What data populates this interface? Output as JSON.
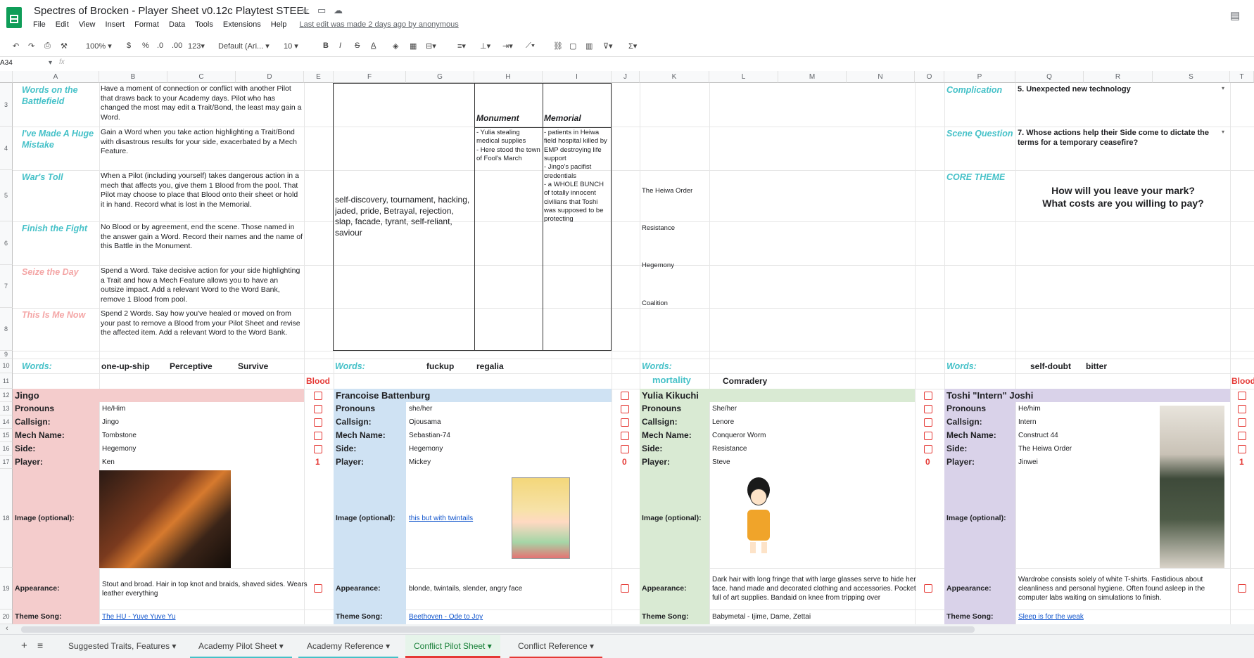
{
  "header": {
    "title": "Spectres of Brocken - Player Sheet v0.12c Playtest STEEL",
    "menus": [
      "File",
      "Edit",
      "View",
      "Insert",
      "Format",
      "Data",
      "Tools",
      "Extensions",
      "Help"
    ],
    "last_edit": "Last edit was made 2 days ago by anonymous"
  },
  "toolbar": {
    "zoom": "100%",
    "currency": "$",
    "percent": "%",
    "dec_minus": ".0",
    "dec_plus": ".00",
    "format_123": "123",
    "font": "Default (Ari...",
    "font_size": "10"
  },
  "formula_bar": {
    "name_box": "A34",
    "fx": "fx"
  },
  "columns": [
    "A",
    "B",
    "C",
    "D",
    "E",
    "F",
    "G",
    "H",
    "I",
    "J",
    "K",
    "L",
    "M",
    "N",
    "O",
    "P",
    "Q",
    "R",
    "S",
    "T"
  ],
  "rows": [
    "3",
    "4",
    "5",
    "6",
    "7",
    "8",
    "9",
    "10",
    "11",
    "12",
    "13",
    "14",
    "15",
    "16",
    "17",
    "18",
    "19",
    "20"
  ],
  "moves": [
    {
      "name": "Words on the Battlefield",
      "text": "Have a moment of connection or conflict  with another Pilot that draws back to your Academy days. Pilot who has changed the most may edit a Trait/Bond, the least may gain a Word."
    },
    {
      "name": "I've Made A Huge Mistake",
      "text": "Gain a Word when you take action highlighting a Trait/Bond with disastrous results for your side, exacerbated by a Mech Feature."
    },
    {
      "name": "War's Toll",
      "text": "When a Pilot (including yourself) takes dangerous action in a mech that affects you, give them 1 Blood from the pool. That Pilot may choose to place that Blood onto their sheet or hold it in hand. Record what is lost in the Memorial."
    },
    {
      "name": "Finish the Fight",
      "text": "No Blood or by agreement, end the scene. Those named in the answer gain a Word. Record their names and the name of this Battle in the Monument."
    },
    {
      "name": "Seize the Day",
      "text": "Spend a Word. Take decisive action for your side highlighting a Trait and how a Mech Feature allows you to have an outsize impact. Add a relevant Word to the Word Bank, remove 1 Blood from pool."
    },
    {
      "name": "This Is Me Now",
      "text": "Spend 2 Words. Say how you've healed or moved on from your past to remove a Blood from your Pilot Sheet and revise the affected item. Add a relevant Word to the Word Bank."
    }
  ],
  "word_bank": "self-discovery, tournament, hacking, jaded, pride, Betrayal, rejection, slap, facade, tyrant, self-reliant, saviour",
  "monument": {
    "title": "Monument",
    "text": "- Yulia stealing medical supplies\n- Here stood the town of Fool's March"
  },
  "memorial": {
    "title": "Memorial",
    "text": "- patients in Heiwa field hospital killed by EMP destroying life support\n- Jingo's pacifist credentials\n- a WHOLE BUNCH of totally innocent civilians that Toshi was supposed to be protecting"
  },
  "sides": [
    "The Heiwa Order",
    "Resistance",
    "Hegemony",
    "Coalition"
  ],
  "complication": {
    "label": "Complication",
    "value": "5. Unexpected new technology"
  },
  "scene_question": {
    "label": "Scene Question",
    "value": "7. Whose actions help their Side come to dictate the terms for a temporary ceasefire?"
  },
  "core_theme": {
    "label": "CORE THEME",
    "value": "How will you leave your mark?\nWhat costs are you willing to pay?"
  },
  "words_row": {
    "label": "Words:",
    "a": [
      "one-up-ship",
      "Perceptive",
      "Survive"
    ],
    "b": [
      "fuckup",
      "regalia"
    ],
    "d": [
      "self-doubt",
      "bitter"
    ]
  },
  "row11": {
    "blood": "Blood",
    "mortality": "mortality",
    "comradery": "Comradery"
  },
  "field_labels": {
    "pronouns": "Pronouns",
    "callsign": "Callsign:",
    "mech": "Mech Name:",
    "side": "Side:",
    "player": "Player:",
    "image": "Image (optional):",
    "appearance": "Appearance:",
    "theme": "Theme Song:"
  },
  "pilots": [
    {
      "name": "Jingo",
      "pronouns": "He/Him",
      "callsign": "Jingo",
      "mech": "Tombstone",
      "side": "Hegemony",
      "player": "Ken",
      "blood": "1",
      "image_link": "",
      "appearance": "Stout and broad. Hair in top knot and braids, shaved sides. Wears leather everything",
      "theme": "The HU - Yuve Yuve Yu",
      "color": "#f4cccc"
    },
    {
      "name": "Francoise Battenburg",
      "pronouns": "she/her",
      "callsign": "Ojousama",
      "mech": "Sebastian-74",
      "side": "Hegemony",
      "player": "Mickey",
      "blood": "0",
      "image_link": "this but with twintails",
      "appearance": "blonde, twintails, slender, angry face",
      "theme": "Beethoven - Ode to Joy",
      "color": "#cfe2f3"
    },
    {
      "name": "Yulia Kikuchi",
      "pronouns": "She/her",
      "callsign": "Lenore",
      "mech": "Conqueror Worm",
      "side": "Resistance",
      "player": "Steve",
      "blood": "0",
      "image_link": "",
      "appearance": "Dark hair with long fringe that with large glasses serve to hide her face. hand made and decorated clothing and accessories. Pocket full of art supplies. Bandaid on knee from tripping over",
      "theme": "Babymetal - Ijime, Dame, Zettai",
      "color": "#d9ead3"
    },
    {
      "name": "Toshi \"Intern\" Joshi",
      "pronouns": "He/him",
      "callsign": "Intern",
      "mech": "Construct 44",
      "side": "The Heiwa Order",
      "player": "Jinwei",
      "blood": "1",
      "image_link": "",
      "appearance": "Wardrobe consists solely of white T-shirts. Fastidious about cleanliness and personal hygiene. Often found asleep in the computer labs waiting on simulations to finish.",
      "theme": "Sleep is for the weak",
      "color": "#d9d2e9"
    }
  ],
  "sheet_tabs": [
    "Suggested Traits, Features",
    "Academy Pilot Sheet",
    "Academy Reference",
    "Conflict Pilot Sheet",
    "Conflict Reference"
  ],
  "colors": {
    "accent_teal": "#45c1c8",
    "active_tab_underline": "#e53935",
    "checkbox_red": "#e53935",
    "sheets_green": "#0f9d58"
  }
}
